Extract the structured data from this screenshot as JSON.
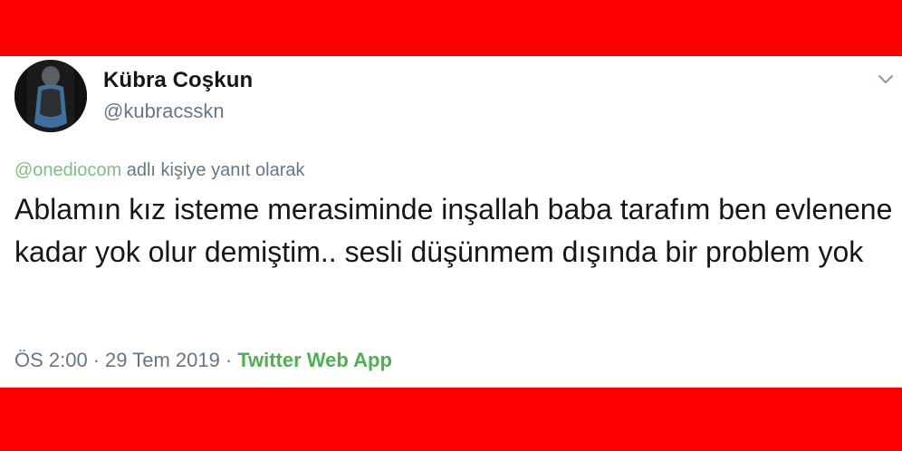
{
  "tweet": {
    "author": {
      "name": "Kübra Coşkun",
      "handle": "@kubracsskn"
    },
    "reply_to": {
      "mention": "@onediocom",
      "suffix": "adlı kişiye yanıt olarak"
    },
    "text": "Ablamın kız isteme merasiminde inşallah baba tarafım ben evlenene kadar yok olur demiştim.. sesli düşünmem dışında bir problem yok",
    "time": "ÖS 2:00",
    "separator": "·",
    "date": "29 Tem 2019",
    "source": "Twitter Web App"
  },
  "icons": {
    "menu": "chevron-down-icon",
    "avatar": "avatar"
  },
  "colors": {
    "frame": "#ff0000",
    "card": "#ffffff",
    "text": "#14171a",
    "muted": "#657786",
    "link_green": "#4fb04f"
  }
}
